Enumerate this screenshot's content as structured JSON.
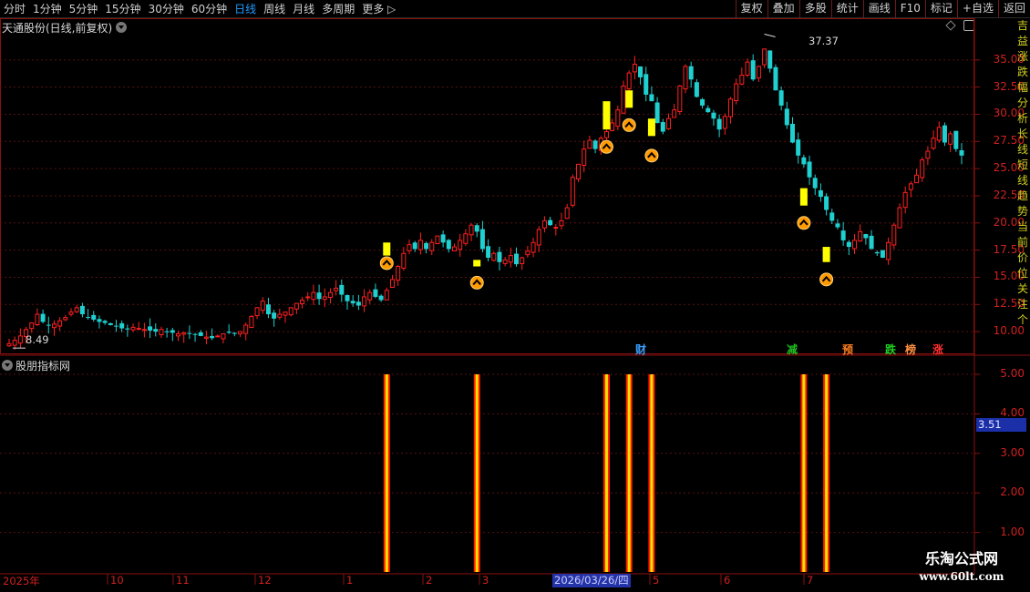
{
  "toolbar": {
    "period_tabs": [
      "分时",
      "1分钟",
      "5分钟",
      "15分钟",
      "30分钟",
      "60分钟",
      "日线",
      "周线",
      "月线",
      "多周期",
      "更多 ▷"
    ],
    "active_tab": "日线",
    "right_tools": [
      "复权",
      "叠加",
      "多股",
      "统计",
      "画线",
      "F10",
      "标记",
      "+自选",
      "返回"
    ]
  },
  "main_panel": {
    "title": "天通股份(日线,前复权)",
    "y_axis_ticks": [
      "35.00",
      "32.50",
      "30.00",
      "27.50",
      "25.00",
      "22.50",
      "20.00",
      "17.50",
      "15.00",
      "12.50",
      "10.00"
    ],
    "low_label": "8.49",
    "high_label": "37.37",
    "event_tags": [
      {
        "text": "财",
        "color": "#3aa0ff"
      },
      {
        "text": "减",
        "color": "#20c020"
      },
      {
        "text": "预",
        "color": "#ff8020"
      },
      {
        "text": "跌",
        "color": "#20d020"
      },
      {
        "text": "榜",
        "color": "#ff9040"
      },
      {
        "text": "涨",
        "color": "#ff3030"
      }
    ]
  },
  "indicator_panel": {
    "title": "股朋指标网",
    "y_axis_ticks": [
      "5.00",
      "4.00",
      "3.00",
      "2.00",
      "1.00"
    ],
    "current_value": "3.51",
    "signal_bars": [
      1,
      1,
      1,
      1,
      1,
      1,
      1
    ]
  },
  "x_axis": {
    "labels": [
      "2025年",
      "10",
      "11",
      "12",
      "1",
      "2",
      "3",
      "5",
      "6",
      "7"
    ],
    "current_date": "2026/03/26/四"
  },
  "sidebar_chars": [
    "吉",
    "益",
    "涨",
    "跌",
    "幅",
    "分",
    "析",
    "长",
    "线",
    "短",
    "线",
    "趋",
    "势",
    "当",
    "前",
    "价",
    "位",
    "关",
    "注",
    "个"
  ],
  "watermark": {
    "line1": "乐淘公式网",
    "line2": "www.60lt.com"
  },
  "colors": {
    "up": "#ff2020",
    "down": "#20d0d0",
    "signal_yellow": "#ffff00",
    "axis_red": "#d02020",
    "grid": "#5a1010",
    "active_tab": "#1e9bff"
  },
  "chart_data": {
    "type": "candlestick",
    "title": "天通股份(日线,前复权)",
    "ylim": [
      8,
      38
    ],
    "price_labels": {
      "low": 8.49,
      "high": 37.37
    },
    "closes": [
      8.9,
      9.2,
      9.6,
      10.2,
      10.8,
      11.6,
      10.9,
      10.6,
      10.7,
      11.0,
      11.3,
      11.8,
      12.2,
      11.6,
      11.3,
      11.1,
      10.9,
      10.8,
      10.6,
      10.5,
      10.3,
      10.2,
      10.4,
      10.3,
      10.2,
      10.1,
      10.0,
      10.2,
      10.0,
      9.9,
      9.8,
      9.9,
      9.8,
      9.7,
      9.6,
      9.5,
      9.4,
      9.6,
      9.8,
      9.9,
      9.8,
      10.0,
      10.6,
      11.4,
      12.2,
      12.8,
      11.6,
      11.2,
      11.6,
      11.8,
      12.2,
      12.6,
      12.9,
      13.2,
      13.6,
      13.0,
      13.2,
      13.6,
      14.0,
      13.4,
      12.8,
      12.6,
      12.4,
      13.2,
      13.6,
      13.2,
      12.9,
      13.8,
      14.8,
      16.0,
      17.2,
      18.0,
      17.6,
      18.4,
      17.6,
      18.2,
      18.8,
      18.2,
      17.6,
      17.8,
      18.4,
      19.0,
      19.8,
      19.2,
      17.6,
      16.8,
      17.2,
      16.4,
      16.6,
      17.0,
      16.2,
      16.8,
      17.4,
      18.2,
      19.4,
      20.2,
      19.8,
      19.6,
      20.2,
      21.4,
      24.2,
      25.4,
      26.8,
      27.6,
      26.8,
      27.8,
      28.4,
      29.2,
      30.4,
      32.6,
      33.8,
      34.6,
      33.4,
      31.8,
      31.2,
      29.2,
      28.4,
      29.6,
      30.4,
      32.6,
      34.4,
      33.2,
      31.6,
      30.8,
      30.2,
      29.6,
      28.6,
      29.8,
      31.4,
      32.8,
      33.6,
      34.8,
      33.2,
      34.4,
      36.0,
      34.2,
      32.2,
      30.8,
      29.0,
      27.4,
      26.2,
      25.4,
      24.2,
      23.2,
      22.4,
      21.2,
      20.2,
      19.6,
      18.4,
      17.8,
      18.4,
      19.2,
      18.6,
      17.6,
      17.2,
      16.8,
      18.2,
      19.8,
      21.4,
      22.8,
      23.6,
      24.4,
      25.8,
      26.6,
      27.8,
      28.8,
      27.4,
      28.2,
      26.8,
      26.2
    ],
    "signals": [
      {
        "candle": 67,
        "low": 17.0,
        "high": 18.2,
        "arrow_price": 16.3
      },
      {
        "candle": 83,
        "low": 16.0,
        "high": 16.6,
        "arrow_price": 14.5
      },
      {
        "candle": 106,
        "low": 28.6,
        "high": 31.2,
        "arrow_price": 27.0
      },
      {
        "candle": 110,
        "low": 30.6,
        "high": 32.2,
        "arrow_price": 29.0
      },
      {
        "candle": 114,
        "low": 28.0,
        "high": 29.6,
        "arrow_price": 26.2
      },
      {
        "candle": 141,
        "low": 21.6,
        "high": 23.2,
        "arrow_price": 20.0
      },
      {
        "candle": 145,
        "low": 16.4,
        "high": 17.8,
        "arrow_price": 14.8
      }
    ],
    "indicator_ylim": [
      0,
      5.5
    ],
    "indicator_value": 3.51
  }
}
